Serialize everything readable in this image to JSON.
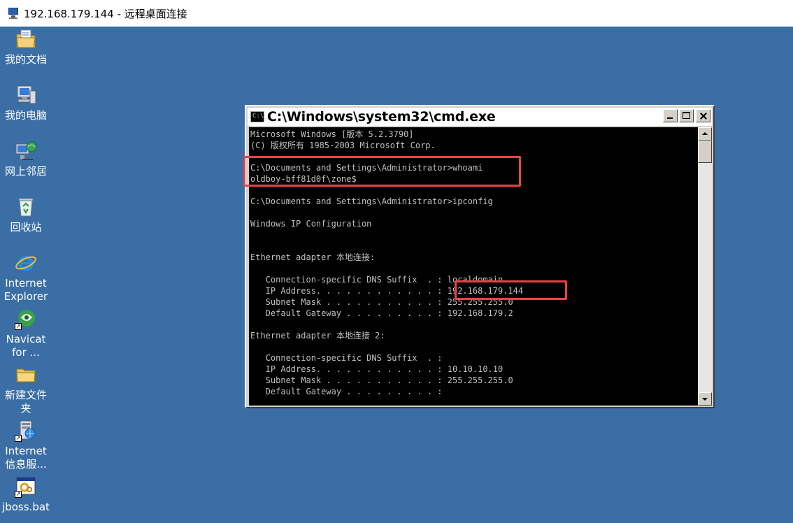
{
  "rdp": {
    "title": "192.168.179.144 - 远程桌面连接"
  },
  "desktop": {
    "icons": [
      {
        "label": "我的文档",
        "icon": "my-documents-icon"
      },
      {
        "label": "我的电脑",
        "icon": "my-computer-icon"
      },
      {
        "label": "网上邻居",
        "icon": "network-places-icon"
      },
      {
        "label": "回收站",
        "icon": "recycle-bin-icon"
      },
      {
        "label": "Internet Explorer",
        "icon": "internet-explorer-icon"
      },
      {
        "label": "Navicat for ...",
        "icon": "navicat-icon"
      },
      {
        "label": "新建文件夹",
        "icon": "folder-icon"
      },
      {
        "label": "Internet 信息服...",
        "icon": "iis-icon"
      },
      {
        "label": "jboss.bat",
        "icon": "batch-file-icon"
      }
    ]
  },
  "cmd": {
    "title": "C:\\Windows\\system32\\cmd.exe",
    "icon_text": "C:\\_",
    "lines": [
      "Microsoft Windows [版本 5.2.3790]",
      "(C) 版权所有 1985-2003 Microsoft Corp.",
      "",
      "C:\\Documents and Settings\\Administrator>whoami",
      "oldboy-bff81d0f\\zone$",
      "",
      "C:\\Documents and Settings\\Administrator>ipconfig",
      "",
      "Windows IP Configuration",
      "",
      "",
      "Ethernet adapter 本地连接:",
      "",
      "   Connection-specific DNS Suffix  . : localdomain",
      "   IP Address. . . . . . . . . . . . : 192.168.179.144",
      "   Subnet Mask . . . . . . . . . . . : 255.255.255.0",
      "   Default Gateway . . . . . . . . . : 192.168.179.2",
      "",
      "Ethernet adapter 本地连接 2:",
      "",
      "   Connection-specific DNS Suffix  . :",
      "   IP Address. . . . . . . . . . . . : 10.10.10.10",
      "   Subnet Mask . . . . . . . . . . . : 255.255.255.0",
      "   Default Gateway . . . . . . . . . :"
    ]
  },
  "colors": {
    "desktop": "#3a6ea5",
    "console_bg": "#000000",
    "console_fg": "#c0c0c0",
    "highlight": "#e8414a"
  }
}
